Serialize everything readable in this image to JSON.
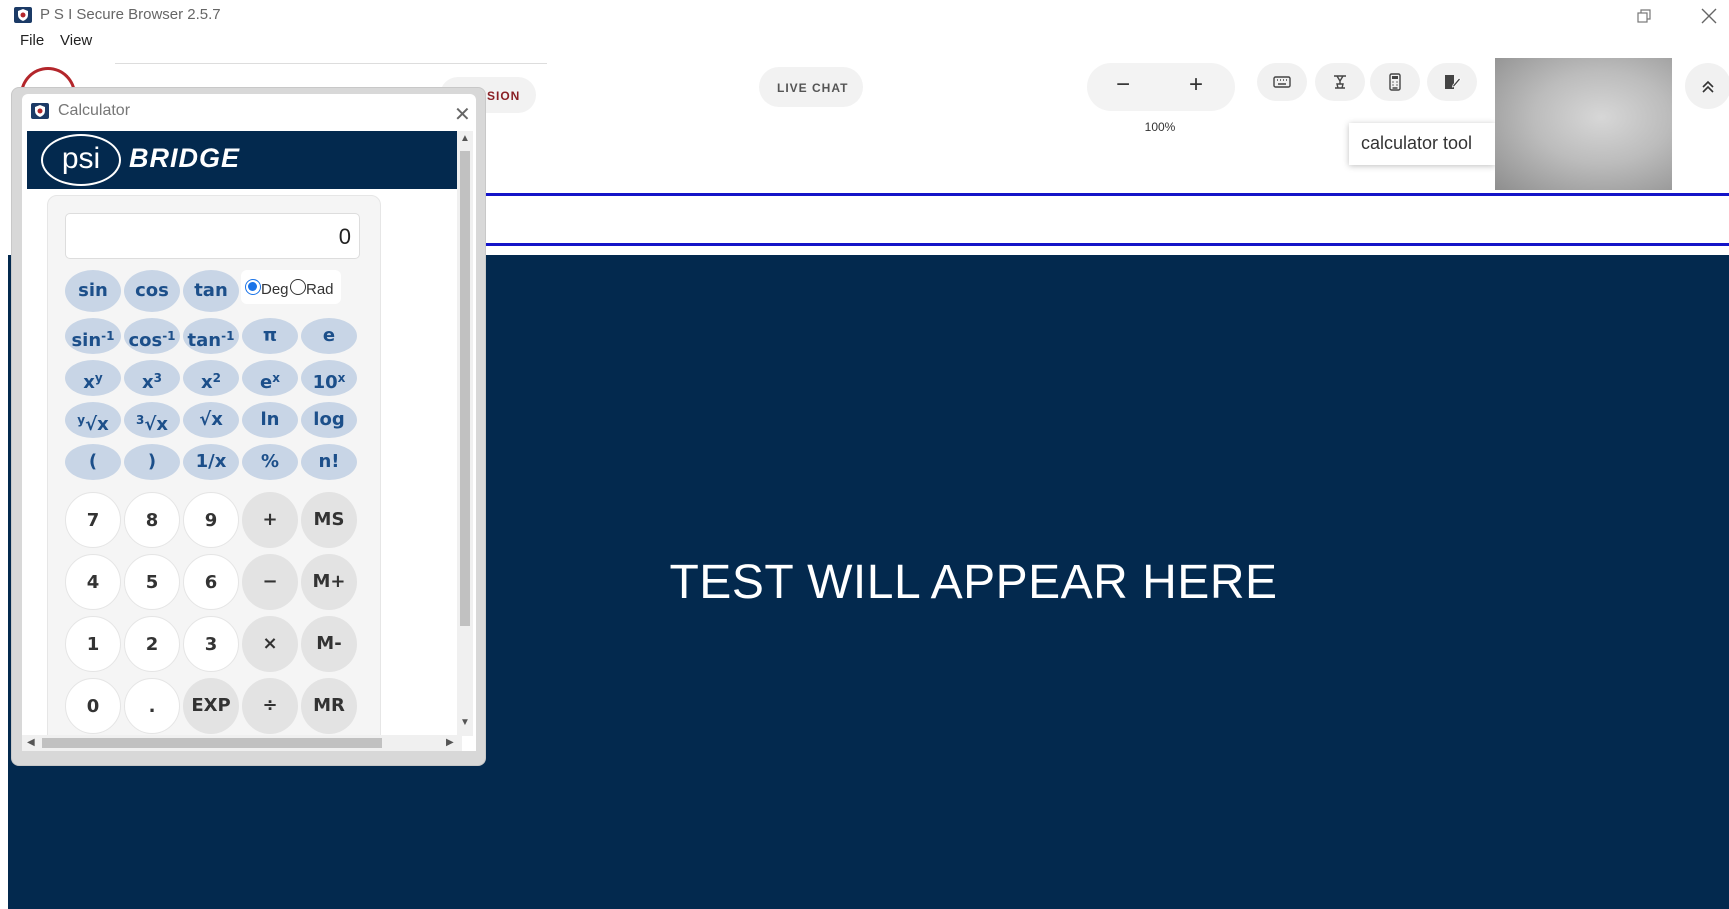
{
  "window": {
    "title": "P S I Secure Browser 2.5.7",
    "menu": [
      "File",
      "View"
    ]
  },
  "toolbar": {
    "partial_button_text": "SSION",
    "live_chat_label": "LIVE CHAT",
    "zoom_out_label": "−",
    "zoom_in_label": "+",
    "zoom_level": "100%",
    "tools": [
      {
        "name": "keyboard-icon"
      },
      {
        "name": "highlighter-icon"
      },
      {
        "name": "calculator-icon"
      },
      {
        "name": "notepad-icon"
      }
    ],
    "tooltip": "calculator tool"
  },
  "main": {
    "message": "TEST WILL APPEAR HERE"
  },
  "calculator": {
    "title": "Calculator",
    "brand_psi": "psi",
    "brand_bridge": "BRIDGE",
    "display_value": "0",
    "angle_mode": {
      "deg_label": "Deg",
      "rad_label": "Rad",
      "selected": "Deg"
    },
    "trig_row": [
      "sin",
      "cos",
      "tan"
    ],
    "inverse_row": [
      "π",
      "e"
    ],
    "scientific_rows": [
      [
        "(",
        ")",
        "1/x",
        "%",
        "n!"
      ]
    ],
    "root_row": [
      "ln",
      "log"
    ],
    "digit_rows": [
      [
        "7",
        "8",
        "9",
        "+",
        "MS"
      ],
      [
        "4",
        "5",
        "6",
        "−",
        "M+"
      ],
      [
        "1",
        "2",
        "3",
        "×",
        "M-"
      ],
      [
        "0",
        ".",
        "EXP",
        "÷",
        "MR"
      ]
    ]
  },
  "colors": {
    "brand_navy": "#03294e",
    "sci_key": "#c8d5e6",
    "sci_key_text": "#1c4f8a",
    "focus_border": "#1414c8"
  }
}
